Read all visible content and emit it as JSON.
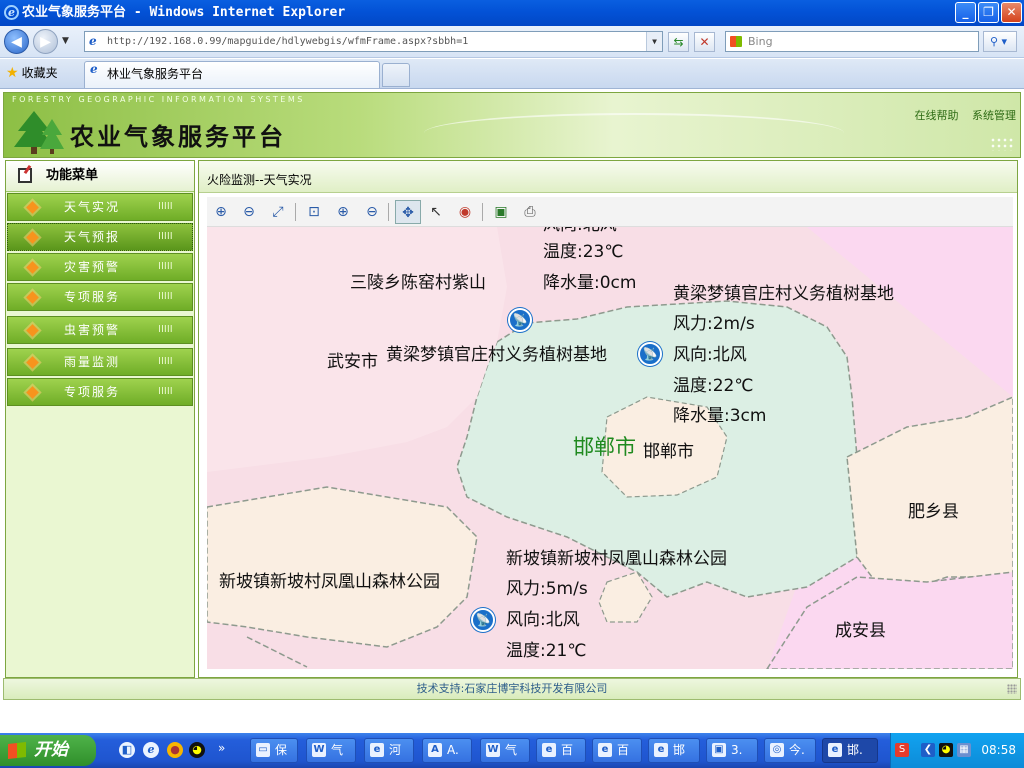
{
  "window": {
    "title": "农业气象服务平台 - Windows Internet Explorer",
    "buttons": {
      "minimize": "_",
      "maximize": "❐",
      "close": "✕"
    }
  },
  "nav": {
    "back_icon": "arrow-left-icon",
    "forward_icon": "arrow-right-icon",
    "address": "http://192.168.0.99/mapguide/hdlywebgis/wfmFrame.aspx?sbbh=1",
    "search_placeholder": "Bing"
  },
  "favorites": {
    "label": "收藏夹",
    "tab_title": "林业气象服务平台"
  },
  "header": {
    "slogan": "FORESTRY GEOGRAPHIC INFORMATION SYSTEMS",
    "app_title": "农业气象服务平台",
    "links": [
      "在线帮助",
      "系统管理"
    ]
  },
  "sidebar": {
    "title": "功能菜单",
    "items": [
      {
        "label": "天气实况",
        "active": false
      },
      {
        "label": "天气预报",
        "active": true
      },
      {
        "label": "灾害预警",
        "active": false
      },
      {
        "label": "专项服务",
        "active": false
      },
      {
        "label": "虫害预警",
        "active": false
      },
      {
        "label": "雨量监测",
        "active": false
      },
      {
        "label": "专项服务",
        "active": false
      }
    ],
    "bars_glyph": "IIIII"
  },
  "main": {
    "panel_title": "火险监测--天气实况",
    "toolbar": [
      "zoom-rect-in-icon",
      "zoom-rect-out-icon",
      "zoom-extent-icon",
      "zoom-previous-icon",
      "zoom-in-icon",
      "zoom-out-icon",
      "pan-icon",
      "select-icon",
      "identify-icon",
      "refresh-icon",
      "print-icon"
    ]
  },
  "map": {
    "colors": {
      "pink": "#f8dee6",
      "green": "#dcefe4",
      "beige": "#faeee2",
      "violet": "#fbd8f0",
      "border": "#8e9a8e"
    },
    "labels": {
      "truncated_top": "风向:北风",
      "temp1": "温度:23℃",
      "rain1": "降水量:0cm",
      "place_sanling": "三陵乡陈窑村紫山",
      "wuan": "武安市",
      "huangliang_left": "黄梁梦镇官庄村义务植树基地",
      "huangliang_right": "黄梁梦镇官庄村义务植树基地",
      "wind2": "风力:2m/s",
      "dir2": "风向:北风",
      "temp2": "温度:22℃",
      "rain2": "降水量:3cm",
      "city_big": "邯郸市",
      "city_small": "邯郸市",
      "feixiang": "肥乡县",
      "xinpo_left": "新坡镇新坡村凤凰山森林公园",
      "xinpo_right": "新坡镇新坡村凤凰山森林公园",
      "wind3": "风力:5m/s",
      "dir3": "风向:北风",
      "temp3": "温度:21℃",
      "chengan": "成安县"
    },
    "station_icon": "satellite-dish-icon"
  },
  "footer": {
    "text": "技术支持:石家庄博宇科技开发有限公司"
  },
  "taskbar": {
    "start": "开始",
    "quick_launch_more": "»",
    "tasks": [
      {
        "label": "保",
        "icon": "folder-icon",
        "glyph": "▭",
        "active": false
      },
      {
        "label": "气",
        "icon": "document-icon",
        "glyph": "W",
        "active": false
      },
      {
        "label": "河",
        "icon": "ie-icon",
        "glyph": "e",
        "active": false
      },
      {
        "label": "A.",
        "icon": "app-icon",
        "glyph": "A",
        "active": false
      },
      {
        "label": "气",
        "icon": "document-icon",
        "glyph": "W",
        "active": false
      },
      {
        "label": "百",
        "icon": "ie-icon",
        "glyph": "e",
        "active": false
      },
      {
        "label": "百",
        "icon": "ie-icon",
        "glyph": "e",
        "active": false
      },
      {
        "label": "邯",
        "icon": "ie-icon",
        "glyph": "e",
        "active": false
      },
      {
        "label": "3.",
        "icon": "image-icon",
        "glyph": "▣",
        "active": false
      },
      {
        "label": "今.",
        "icon": "chrome-icon",
        "glyph": "◎",
        "active": false
      },
      {
        "label": "邯.",
        "icon": "ie-icon",
        "glyph": "e",
        "active": true
      }
    ],
    "clock": "08:58"
  }
}
